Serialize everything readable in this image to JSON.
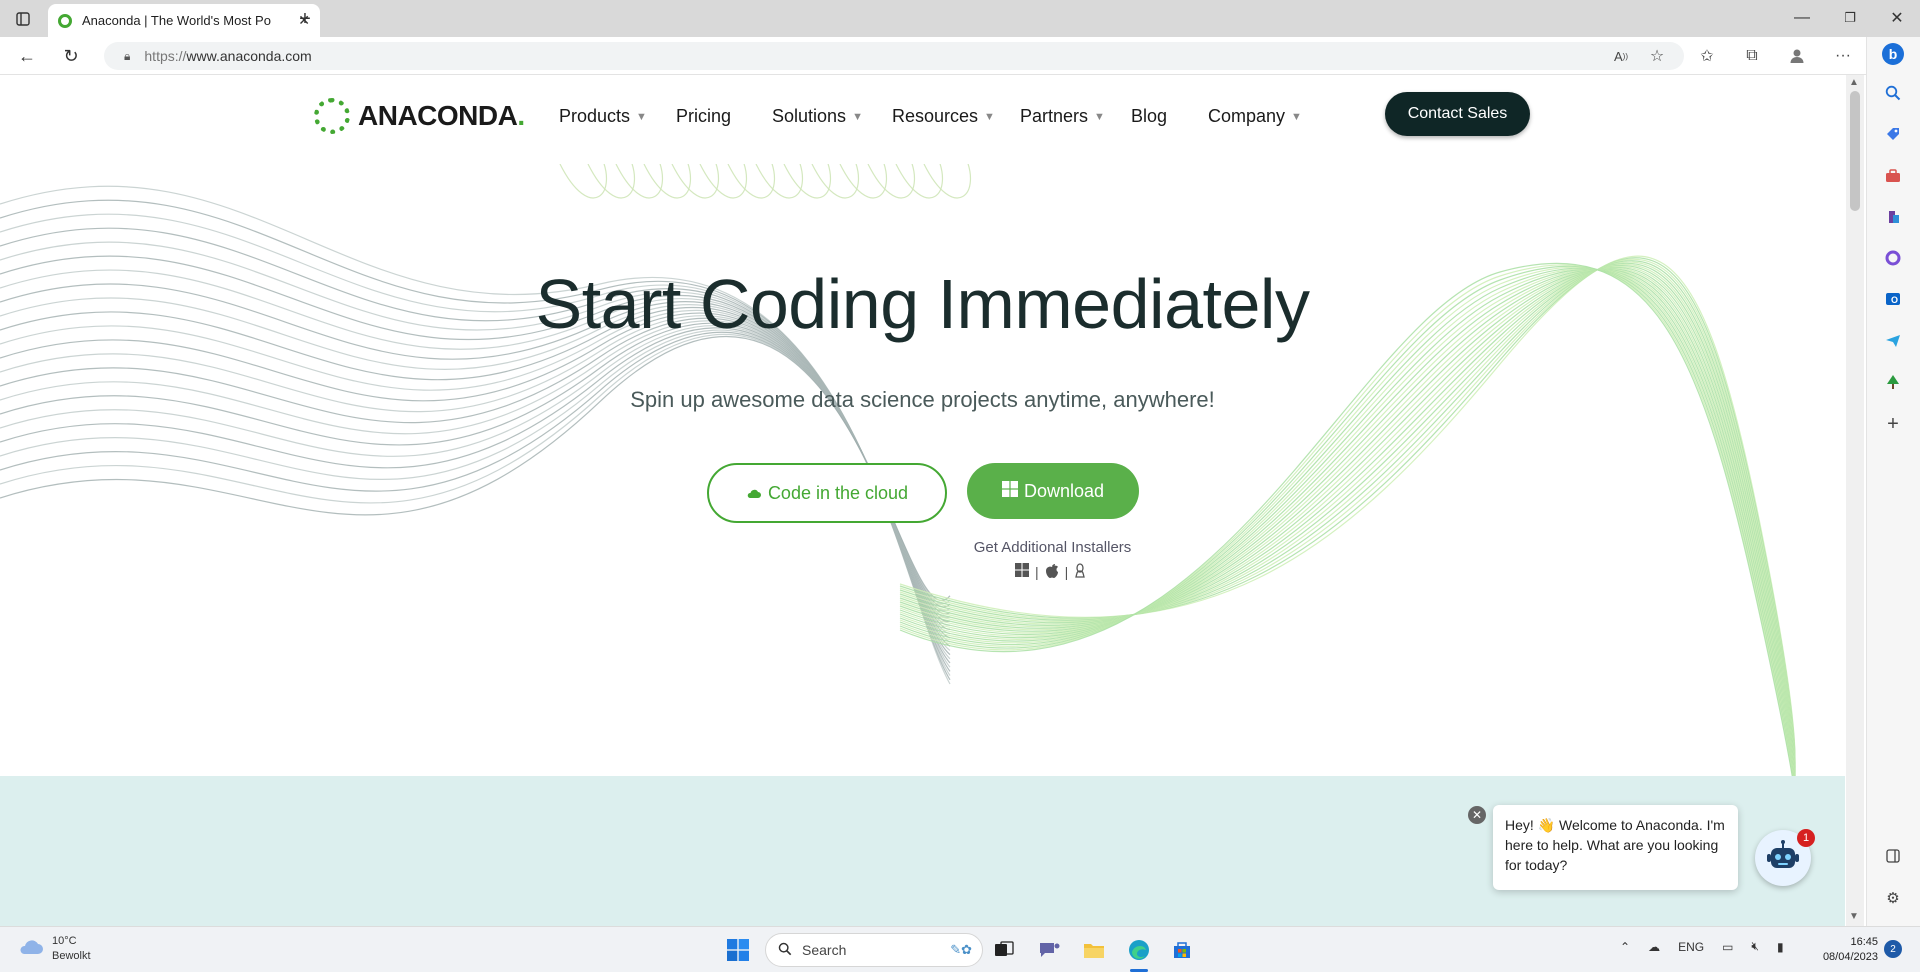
{
  "browser": {
    "tab_title": "Anaconda | The World's Most Po",
    "url_scheme": "https://",
    "url_host": "www.anaconda.com"
  },
  "site": {
    "logo_text": "ANACONDA",
    "logo_dot": ".",
    "nav": [
      {
        "label": "Products",
        "dropdown": true
      },
      {
        "label": "Pricing",
        "dropdown": false
      },
      {
        "label": "Solutions",
        "dropdown": true
      },
      {
        "label": "Resources",
        "dropdown": true
      },
      {
        "label": "Partners",
        "dropdown": true
      },
      {
        "label": "Blog",
        "dropdown": false
      },
      {
        "label": "Company",
        "dropdown": true
      }
    ],
    "contact_label": "Contact Sales"
  },
  "hero": {
    "title": "Start Coding Immediately",
    "subtitle": "Spin up awesome data science projects anytime, anywhere!",
    "cloud_button": "Code in the cloud",
    "download_button": "Download",
    "installers_label": "Get Additional Installers",
    "os_separator": "|"
  },
  "chat": {
    "message": "Hey! 👋 Welcome to Anaconda. I'm here to help. What are you looking for today?",
    "badge_count": "1",
    "close_glyph": "✕"
  },
  "taskbar": {
    "weather_temp": "10°C",
    "weather_desc": "Bewolkt",
    "search_placeholder": "Search",
    "language": "ENG",
    "time": "16:45",
    "date": "08/04/2023",
    "notification_count": "2"
  },
  "colors": {
    "brand_green": "#44a833",
    "dark_button": "#0f2626",
    "band": "#dcefee"
  }
}
